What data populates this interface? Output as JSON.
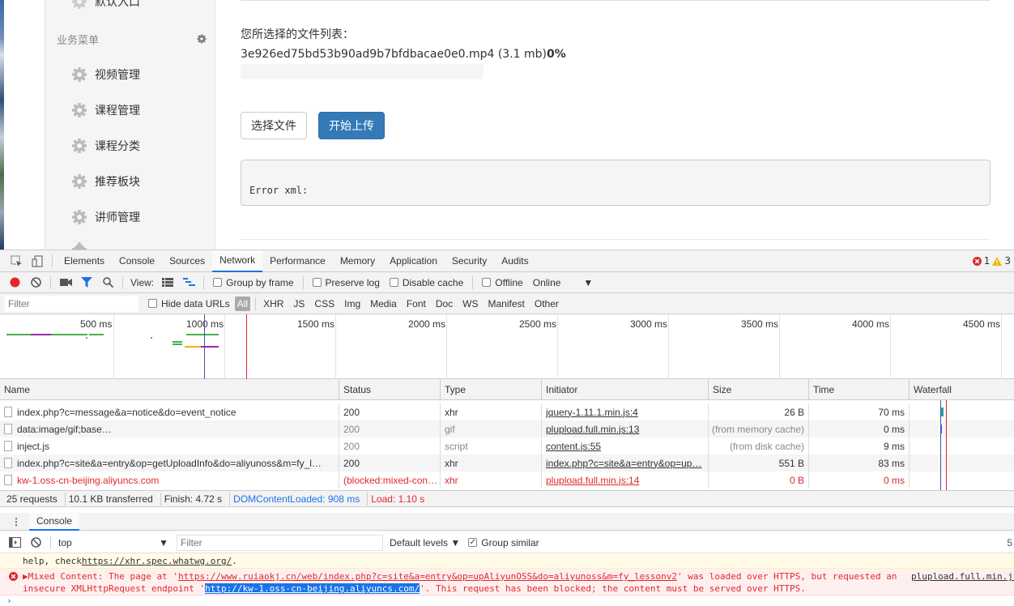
{
  "sidebar": {
    "cut_item_label": "默认入口",
    "section_title": "业务菜单",
    "items": [
      {
        "label": "视频管理"
      },
      {
        "label": "课程管理"
      },
      {
        "label": "课程分类"
      },
      {
        "label": "推荐板块"
      },
      {
        "label": "讲师管理"
      }
    ]
  },
  "main": {
    "file_list_label": "您所选择的文件列表：",
    "file_name": "3e926ed75bd53b90ad9b7bfdbacae0e0.mp4",
    "file_size": "(3.1 mb)",
    "file_percent": "0%",
    "progress_value": 0,
    "select_button": "选择文件",
    "upload_button": "开始上传",
    "error_text": "Error xml:"
  },
  "devtools": {
    "tabs": [
      "Elements",
      "Console",
      "Sources",
      "Network",
      "Performance",
      "Memory",
      "Application",
      "Security",
      "Audits"
    ],
    "active_tab": "Network",
    "error_count": "1",
    "warning_count": "3",
    "toolbar": {
      "view_label": "View:",
      "group_by_frame": "Group by frame",
      "preserve_log": "Preserve log",
      "disable_cache": "Disable cache",
      "offline": "Offline",
      "throttle": "Online"
    },
    "filter": {
      "placeholder": "Filter",
      "hide_data_urls": "Hide data URLs",
      "types": [
        "All",
        "XHR",
        "JS",
        "CSS",
        "Img",
        "Media",
        "Font",
        "Doc",
        "WS",
        "Manifest",
        "Other"
      ]
    },
    "timeline_ticks": [
      "500 ms",
      "1000 ms",
      "1500 ms",
      "2000 ms",
      "2500 ms",
      "3000 ms",
      "3500 ms",
      "4000 ms",
      "4500 ms"
    ],
    "columns": [
      "Name",
      "Status",
      "Type",
      "Initiator",
      "Size",
      "Time",
      "Waterfall"
    ],
    "rows": [
      {
        "name": "index.php?c=message&a=notice&do=event_notice",
        "status": "200",
        "type": "xhr",
        "initiator": "jquery-1.11.1.min.js:4",
        "size": "26 B",
        "time": "70 ms"
      },
      {
        "name": "data:image/gif;base…",
        "status": "200",
        "type": "gif",
        "initiator": "plupload.full.min.js:13",
        "size": "(from memory cache)",
        "time": "0 ms"
      },
      {
        "name": "inject.js",
        "status": "200",
        "type": "script",
        "initiator": "content.js:55",
        "size": "(from disk cache)",
        "time": "9 ms"
      },
      {
        "name": "index.php?c=site&a=entry&op=getUploadInfo&do=aliyunoss&m=fy_l…",
        "status": "200",
        "type": "xhr",
        "initiator": "index.php?c=site&a=entry&op=up…",
        "size": "551 B",
        "time": "83 ms"
      },
      {
        "name": "kw-1.oss-cn-beijing.aliyuncs.com",
        "status": "(blocked:mixed-con…",
        "type": "xhr",
        "initiator": "plupload.full.min.js:14",
        "size": "0 B",
        "time": "0 ms"
      }
    ],
    "summary": {
      "requests": "25 requests",
      "transferred": "10.1 KB transferred",
      "finish": "Finish: 4.72 s",
      "dom_loaded": "DOMContentLoaded: 908 ms",
      "load": "Load: 1.10 s"
    },
    "drawer_tab": "Console",
    "console": {
      "context": "top",
      "filter_placeholder": "Filter",
      "levels": "Default levels",
      "group_similar": "Group similar",
      "right_count": "5",
      "msg1_prefix": "help, check ",
      "msg1_link": "https://xhr.spec.whatwg.org/",
      "msg1_suffix": ".",
      "msg2_a": "▶Mixed Content: The page at '",
      "msg2_url": "https://www.ruiaokj.cn/web/index.php?c=site&a=entry&op=upAliyunOSS&do=aliyunoss&m=fy_lessonv2",
      "msg2_b": "' was loaded over HTTPS, but requested an",
      "msg2_source": "plupload.full.min.js",
      "msg2_c": "insecure XMLHttpRequest endpoint '",
      "msg2_endpoint": "http://kw-1.oss-cn-beijing.aliyuncs.com/",
      "msg2_d": "'. This request has been blocked; the content must be served over HTTPS.",
      "prompt": "›"
    }
  }
}
